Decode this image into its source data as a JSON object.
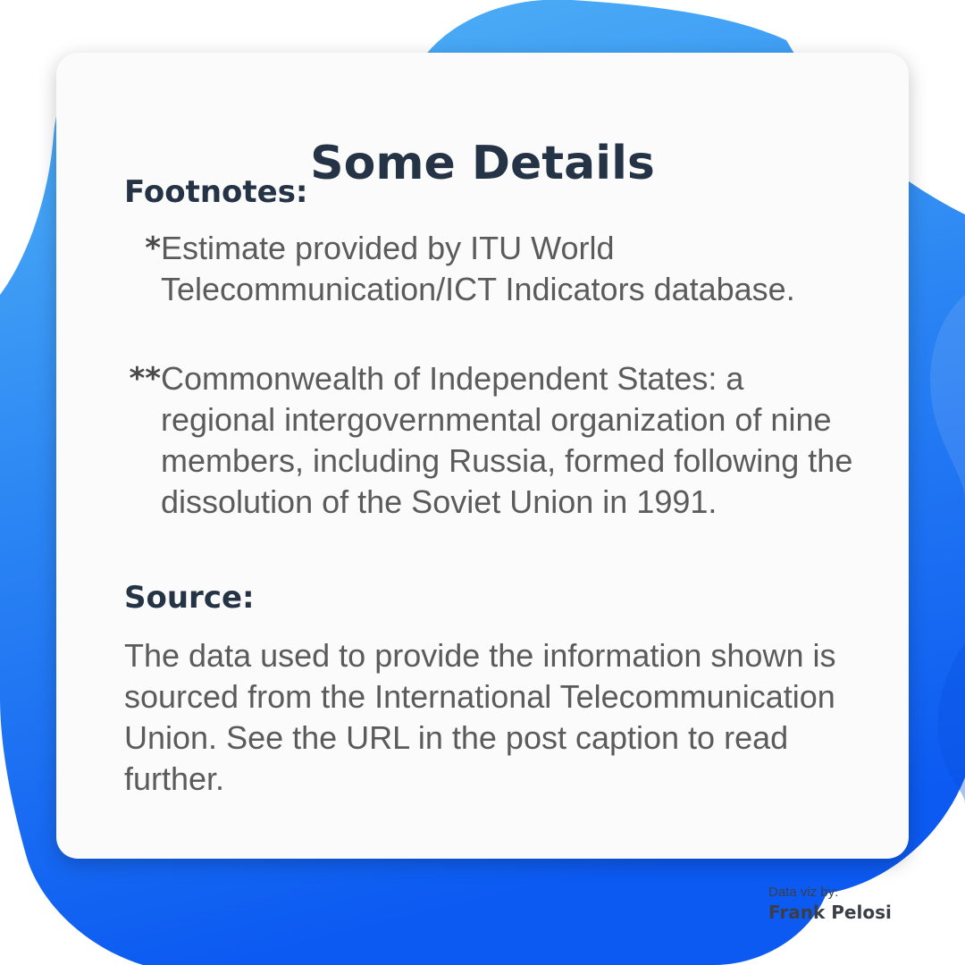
{
  "card": {
    "title": "Some Details",
    "footnotes_heading": "Footnotes:",
    "footnotes": [
      {
        "marker": "*",
        "text": "Estimate provided by ITU World Telecommunication/ICT Indicators database."
      },
      {
        "marker": "**",
        "text": "Commonwealth of Independent States: a regional intergovernmental organization of nine members, including Russia, formed following the dissolution of the Soviet Union in 1991."
      }
    ],
    "source_heading": "Source:",
    "source_text": "The data used to provide the information shown is sourced from the International Telecommunication Union. See the URL in the post caption to read further."
  },
  "credit": {
    "label": "Data viz by:",
    "name": "Frank Pelosi"
  },
  "colors": {
    "background_blob_light": "#4fb2f5",
    "background_blob_dark": "#0d5cf2",
    "card_background": "#fbfbfb",
    "heading_text": "#253346",
    "body_text": "#5b5b5b"
  }
}
